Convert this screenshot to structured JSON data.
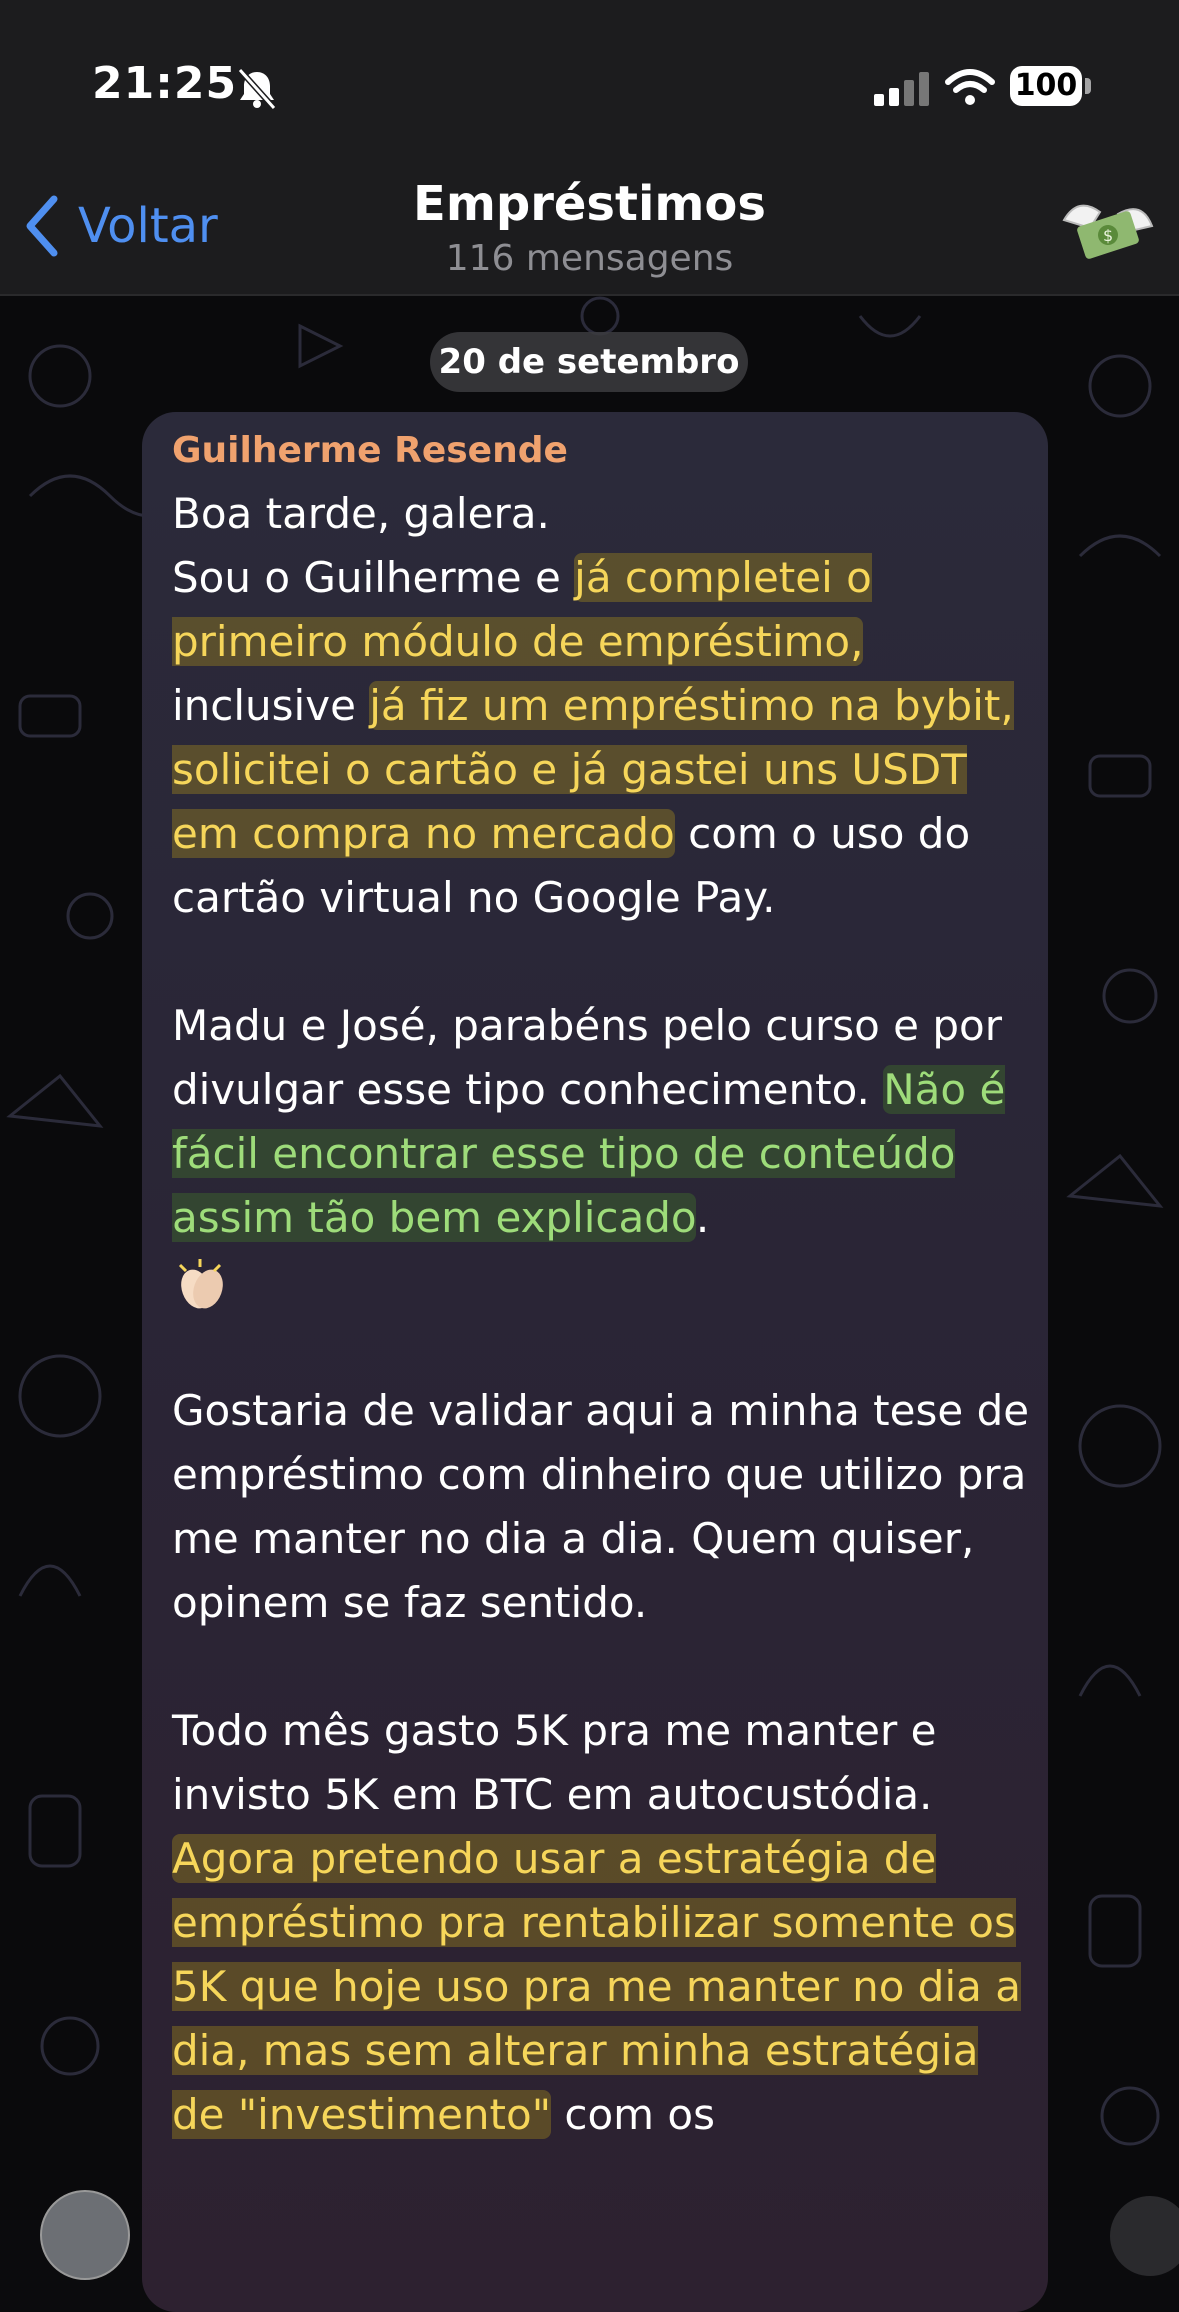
{
  "status_bar": {
    "time": "21:25",
    "battery": "100"
  },
  "header": {
    "back_label": "Voltar",
    "title": "Empréstimos",
    "subtitle": "116 mensagens"
  },
  "date_chip": "20 de setembro",
  "message": {
    "sender": "Guilherme Resende",
    "p1_l1": "Boa tarde, galera.",
    "p1_l2a": "Sou o Guilherme e ",
    "p1_l2b": "já completei o primeiro módulo de empréstimo,",
    "p1_l3a": " inclusive ",
    "p1_l3b": "já fiz um empréstimo na bybit, solicitei o cartão e já gastei uns USDT em compra no mercado",
    "p1_l3c": " com o uso do cartão virtual no Google Pay.",
    "p2a": "Madu e José, parabéns pelo curso e por divulgar esse tipo conhecimento. ",
    "p2b": "Não é fácil encontrar esse tipo de conteúdo assim tão bem explicado",
    "p2c": ".",
    "p3": "Gostaria de validar aqui a minha tese de empréstimo com dinheiro que utilizo pra me manter no dia a dia. Quem quiser, opinem se faz sentido.",
    "p4a": "Todo mês gasto 5K pra me manter e invisto 5K em BTC em autocustódia. ",
    "p4b": "Agora pretendo usar a estratégia de empréstimo pra rentabilizar somente os 5K que hoje uso pra me manter no dia a dia, mas sem alterar minha estratégia de \"investimento\"",
    "p4c": " com os"
  },
  "colors": {
    "accent": "#4f8ff0",
    "sender": "#f0a26e",
    "highlight_yellow": "#f6d65a",
    "highlight_green": "#9edc7a"
  },
  "icons": [
    "chevron-left-icon",
    "bell-slash-icon",
    "signal-icon",
    "wifi-icon",
    "money-wings-icon",
    "clapping-hands-icon"
  ]
}
